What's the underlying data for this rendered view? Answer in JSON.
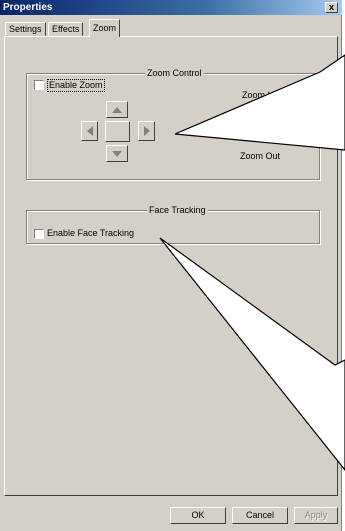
{
  "window": {
    "title": "Properties",
    "close_glyph": "x"
  },
  "tabs": [
    {
      "label": "Settings",
      "active": false
    },
    {
      "label": "Effects",
      "active": false
    },
    {
      "label": "Zoom",
      "active": true
    }
  ],
  "zoom_control": {
    "group_title": "Zoom Control",
    "enable_label": "Enable Zoom",
    "enabled": false,
    "zoom_in_label": "Zoom In",
    "zoom_out_label": "Zoom Out",
    "slider_level": 0
  },
  "face_tracking": {
    "group_title": "Face Tracking",
    "enable_label": "Enable Face Tracking",
    "enabled": false
  },
  "buttons": {
    "ok": "OK",
    "cancel": "Cancel",
    "apply": "Apply"
  },
  "colors": {
    "face": "#d4d0c8",
    "titlebar": "#0a246a",
    "arrow": "#808080"
  }
}
